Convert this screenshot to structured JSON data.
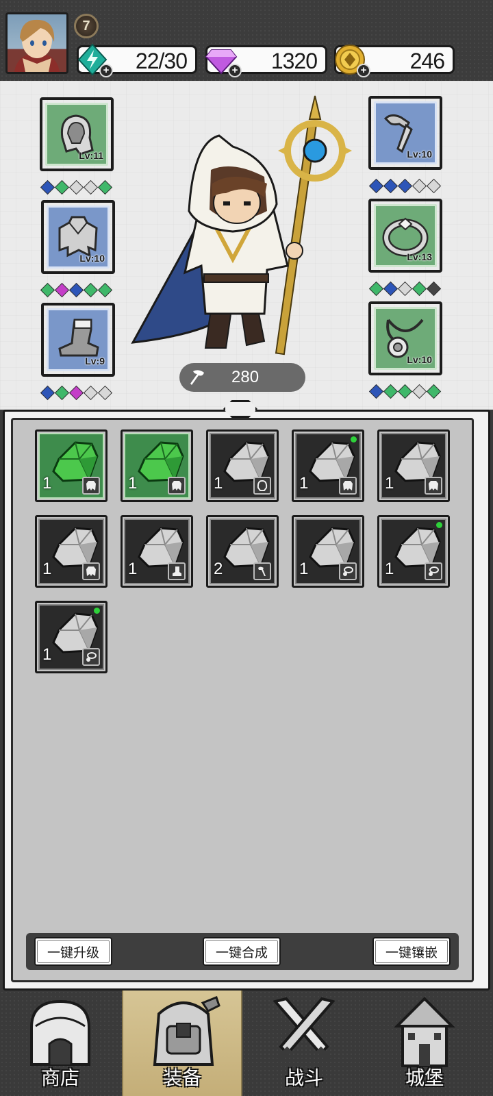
{
  "player": {
    "level": "7"
  },
  "resources": {
    "energy": {
      "value": "22/30",
      "icon": "energy-crystal-icon",
      "color": "#1fae9a"
    },
    "gems": {
      "value": "1320",
      "icon": "purple-diamond-icon",
      "color": "#b44ed8"
    },
    "gold": {
      "value": "246",
      "icon": "gold-coin-icon",
      "color": "#d9a521"
    }
  },
  "equipment": {
    "left": [
      {
        "name": "hood",
        "level": "Lv:11",
        "rarity": "green",
        "gems": [
          "b",
          "g",
          "w",
          "w",
          "g"
        ]
      },
      {
        "name": "cape",
        "level": "Lv:10",
        "rarity": "blue",
        "gems": [
          "g",
          "p",
          "b",
          "g",
          "g"
        ]
      },
      {
        "name": "boots",
        "level": "Lv:9",
        "rarity": "blue",
        "gems": [
          "b",
          "g",
          "p",
          "w",
          "w"
        ]
      }
    ],
    "right": [
      {
        "name": "staff",
        "level": "Lv:10",
        "rarity": "blue",
        "gems": [
          "b",
          "b",
          "b",
          "w",
          "w"
        ]
      },
      {
        "name": "ring",
        "level": "Lv:13",
        "rarity": "green",
        "gems": [
          "g",
          "b",
          "w",
          "g",
          "d"
        ]
      },
      {
        "name": "necklace",
        "level": "Lv:10",
        "rarity": "green",
        "gems": [
          "b",
          "g",
          "g",
          "w",
          "g"
        ]
      }
    ]
  },
  "power": {
    "value": "280",
    "icon": "attack-power-icon"
  },
  "inventory": [
    {
      "count": "1",
      "kind": "green",
      "type": "cape-icon",
      "new": false
    },
    {
      "count": "1",
      "kind": "green",
      "type": "cape-icon",
      "new": false
    },
    {
      "count": "1",
      "kind": "grey",
      "type": "hood-icon",
      "new": false
    },
    {
      "count": "1",
      "kind": "grey",
      "type": "cape-icon",
      "new": true
    },
    {
      "count": "1",
      "kind": "grey",
      "type": "cape-icon",
      "new": false
    },
    {
      "count": "1",
      "kind": "grey",
      "type": "cape-icon",
      "new": false
    },
    {
      "count": "1",
      "kind": "grey",
      "type": "boots-icon",
      "new": false
    },
    {
      "count": "2",
      "kind": "grey",
      "type": "staff-icon",
      "new": false
    },
    {
      "count": "1",
      "kind": "grey",
      "type": "necklace-icon",
      "new": false
    },
    {
      "count": "1",
      "kind": "grey",
      "type": "necklace-icon",
      "new": true
    },
    {
      "count": "1",
      "kind": "grey",
      "type": "necklace-icon",
      "new": true
    }
  ],
  "actions": {
    "upgrade_all": "一键升级",
    "merge_all": "一键合成",
    "socket_all": "一键镶嵌"
  },
  "nav": {
    "shop": "商店",
    "equipment": "装备",
    "battle": "战斗",
    "castle": "城堡",
    "active": "equipment"
  }
}
